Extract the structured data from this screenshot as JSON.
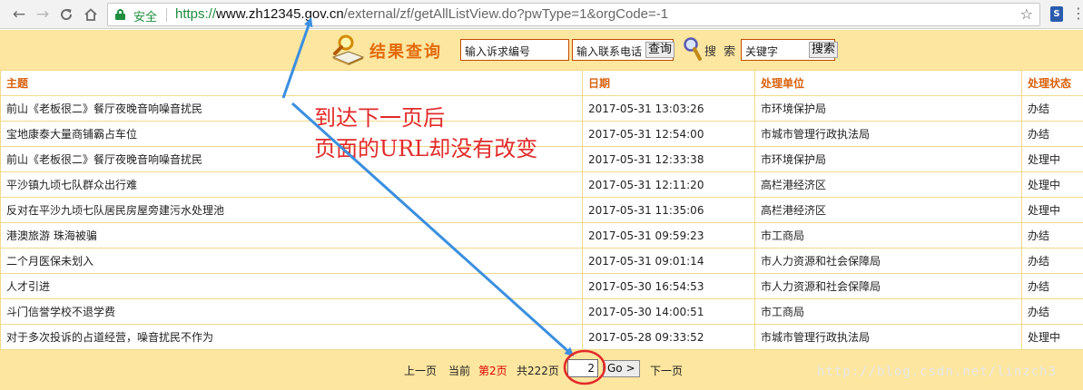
{
  "browser": {
    "back": "←",
    "forward": "→",
    "reload": "C",
    "home": "⌂",
    "secure_label": "安全",
    "url_scheme": "https://",
    "url_host": "www.zh12345.gov.cn",
    "url_path": "/external/zf/getAllListView.do?pwType=1&orgCode=-1",
    "star": "☆",
    "ext_letter": "S",
    "menu": "⋮"
  },
  "querybar": {
    "title": "结果查询",
    "complaint_no_value": "输入诉求编号",
    "phone_value": "输入联系电话",
    "query_button": "查询",
    "search_word": "搜 索",
    "keyword_value": "关键字",
    "search_button": "搜索"
  },
  "table": {
    "headers": [
      "主题",
      "日期",
      "处理单位",
      "处理状态"
    ],
    "rows": [
      [
        "前山《老板很二》餐厅夜晚音响噪音扰民",
        "2017-05-31 13:03:26",
        "市环境保护局",
        "办结"
      ],
      [
        "宝地康泰大量商铺霸占车位",
        "2017-05-31 12:54:00",
        "市城市管理行政执法局",
        "办结"
      ],
      [
        "前山《老板很二》餐厅夜晚音响噪音扰民",
        "2017-05-31 12:33:38",
        "市环境保护局",
        "处理中"
      ],
      [
        "平沙镇九顷七队群众出行难",
        "2017-05-31 12:11:20",
        "高栏港经济区",
        "处理中"
      ],
      [
        "反对在平沙九顷七队居民房屋旁建污水处理池",
        "2017-05-31 11:35:06",
        "高栏港经济区",
        "处理中"
      ],
      [
        "港澳旅游 珠海被骗",
        "2017-05-31 09:59:23",
        "市工商局",
        "办结"
      ],
      [
        "二个月医保未划入",
        "2017-05-31 09:01:14",
        "市人力资源和社会保障局",
        "办结"
      ],
      [
        "人才引进",
        "2017-05-30 16:54:53",
        "市人力资源和社会保障局",
        "办结"
      ],
      [
        "斗门信誉学校不退学费",
        "2017-05-30 14:00:51",
        "市工商局",
        "办结"
      ],
      [
        "对于多次投诉的占道经营，噪音扰民不作为",
        "2017-05-28 09:33:52",
        "市城市管理行政执法局",
        "处理中"
      ]
    ]
  },
  "pager": {
    "prev": "上一页",
    "current_prefix": "当前",
    "current_page": "第2页",
    "total": "共222页",
    "input_value": "2",
    "go_button": "Go >",
    "next": "下一页"
  },
  "watermark": "http://blog.csdn.net/linzch3",
  "annotation": {
    "line1": "到达下一页后",
    "line2": "页面的URL却没有改变",
    "arrow_color": "#3a8fe0",
    "circle_color": "#e22a2a"
  },
  "colors": {
    "bar_bg": "#fce6a0",
    "header_text": "#d9610e",
    "secure_green": "#1e8e3e",
    "current_page_red": "#e00000"
  }
}
